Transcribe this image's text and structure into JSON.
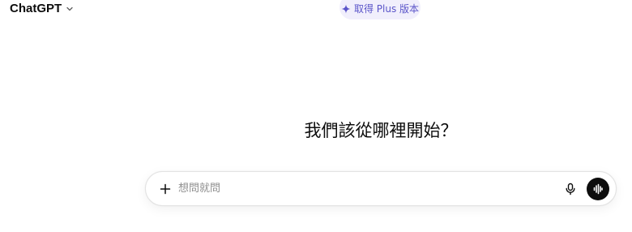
{
  "header": {
    "model_name": "ChatGPT",
    "upgrade_label": "取得 Plus 版本"
  },
  "main": {
    "heading": "我們該從哪裡開始？"
  },
  "composer": {
    "placeholder": "想問就問",
    "value": ""
  },
  "icons": {
    "model_chevron": "chevron-down-icon",
    "upgrade": "sparkle-icon",
    "attach": "plus-icon",
    "dictate": "microphone-icon",
    "voice": "voice-waveform-icon"
  },
  "colors": {
    "accent": "#5b55c9",
    "upgrade_bg": "#f1effc",
    "voice_button": "#0d0d0d"
  }
}
